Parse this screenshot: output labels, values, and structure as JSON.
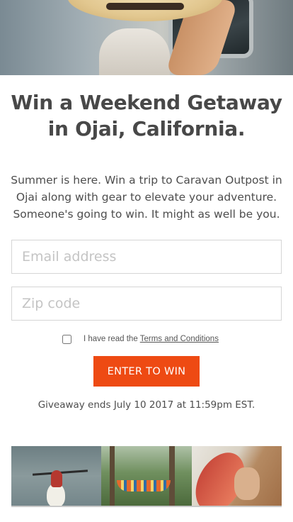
{
  "headline": {
    "line1": "Win a Weekend Getaway",
    "line2": "in Ojai, California."
  },
  "intro": {
    "text": "Summer is here. Win a trip to Caravan Outpost in Ojai along with gear to elevate your adventure. Someone's going to win. It might as well be you."
  },
  "form": {
    "email_placeholder": "Email address",
    "email_value": "",
    "zip_placeholder": "Zip code",
    "zip_value": "",
    "terms_prefix": "I have read the",
    "terms_link": "Terms and Conditions",
    "terms_checked": false,
    "submit_label": "ENTER TO WIN"
  },
  "deadline": {
    "text": "Giveaway ends July 10 2017 at 11:59pm EST."
  },
  "colors": {
    "accent": "#ee4a13",
    "text": "#4a4a4a"
  }
}
